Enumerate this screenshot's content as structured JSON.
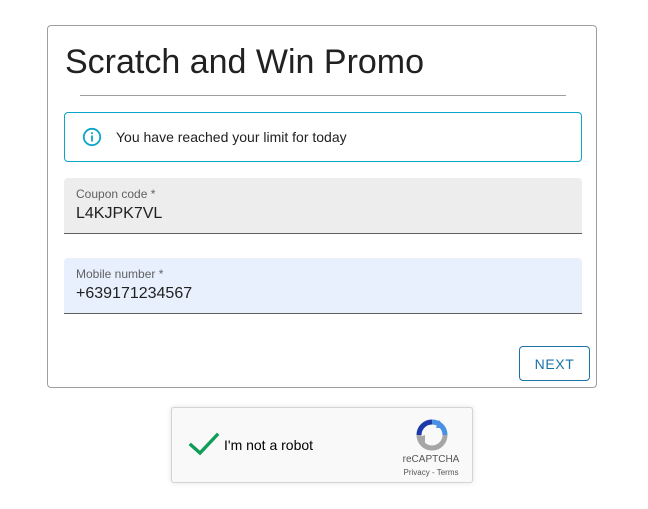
{
  "form": {
    "title": "Scratch and Win Promo",
    "alert": {
      "icon": "info-icon",
      "text": "You have reached your limit for today",
      "color": "#0aa5c8"
    },
    "coupon": {
      "label": "Coupon code *",
      "value": "L4KJPK7VL"
    },
    "mobile": {
      "label": "Mobile number *",
      "value": "+639171234567"
    },
    "next_label": "NEXT",
    "accent_color": "#1a73a8"
  },
  "recaptcha": {
    "checkbox_state": "checked",
    "check_color": "#0f9d58",
    "label": "I'm not a robot",
    "brand": "reCAPTCHA",
    "privacy": "Privacy",
    "separator": " - ",
    "terms": "Terms",
    "logo_icon": "recaptcha-logo-icon"
  }
}
